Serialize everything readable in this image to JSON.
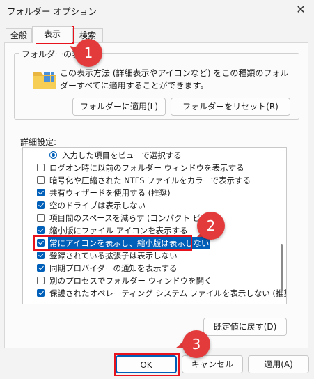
{
  "window": {
    "title": "フォルダー オプション",
    "close_glyph": "✕"
  },
  "tabs": [
    {
      "label": "全般",
      "active": false
    },
    {
      "label": "表示",
      "active": true
    },
    {
      "label": "検索",
      "active": false
    }
  ],
  "folder_views": {
    "group_label": "フォルダーの表示",
    "description": "この表示方法 (詳細表示やアイコンなど) をこの種類のフォルダーすべてに適用することができます。",
    "apply_button": "フォルダーに適用(L)",
    "reset_button": "フォルダーをリセット(R)"
  },
  "advanced": {
    "label": "詳細設定:",
    "items": [
      {
        "type": "radio",
        "checked": true,
        "label": "入力した項目をビューで選択する"
      },
      {
        "type": "checkbox",
        "checked": false,
        "label": "ログオン時に以前のフォルダー ウィンドウを表示する"
      },
      {
        "type": "checkbox",
        "checked": false,
        "label": "暗号化や圧縮された NTFS ファイルをカラーで表示する"
      },
      {
        "type": "checkbox",
        "checked": true,
        "label": "共有ウィザードを使用する (推奨)"
      },
      {
        "type": "checkbox",
        "checked": true,
        "label": "空のドライブは表示しない"
      },
      {
        "type": "checkbox",
        "checked": false,
        "label": "項目間のスペースを減らす (コンパクト ビュー)"
      },
      {
        "type": "checkbox",
        "checked": true,
        "label": "縮小版にファイル アイコンを表示する"
      },
      {
        "type": "checkbox",
        "checked": true,
        "label": "常にアイコンを表示し、縮小版は表示しない",
        "selected": true
      },
      {
        "type": "checkbox",
        "checked": true,
        "label": "登録されている拡張子は表示しない"
      },
      {
        "type": "checkbox",
        "checked": true,
        "label": "同期プロバイダーの通知を表示する"
      },
      {
        "type": "checkbox",
        "checked": false,
        "label": "別のプロセスでフォルダー ウィンドウを開く"
      },
      {
        "type": "checkbox",
        "checked": true,
        "label": "保護されたオペレーティング システム ファイルを表示しない (推奨)"
      }
    ],
    "restore_defaults_button": "既定値に戻す(D)"
  },
  "footer": {
    "ok_button": "OK",
    "cancel_button": "キャンセル",
    "apply_button": "適用(A)"
  },
  "callouts": [
    "1",
    "2",
    "3"
  ],
  "colors": {
    "accent": "#005fb8",
    "callout": "#e33b3b",
    "highlight_box": "#e8121c"
  }
}
